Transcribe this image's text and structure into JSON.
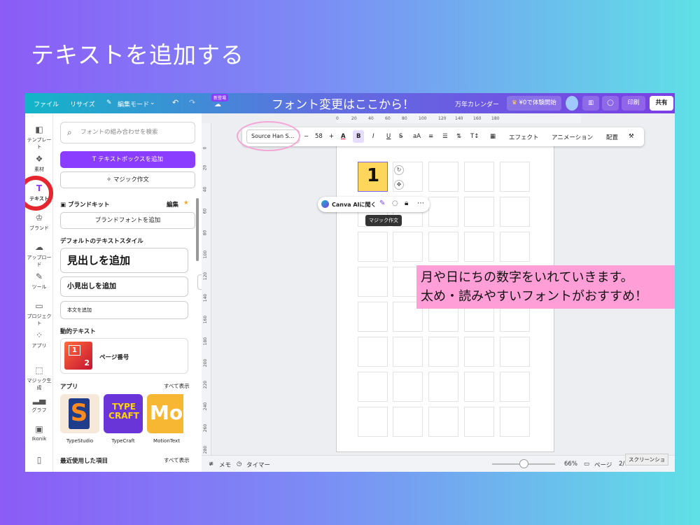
{
  "slide": {
    "title": "テキストを追加する"
  },
  "topbar": {
    "file": "ファイル",
    "resize": "リサイズ",
    "edit_mode": "編集モード",
    "new_badge": "新登場",
    "banner": "フォント変更はここから！",
    "doc_title": "万年カレンダー",
    "trial": "¥0で体験開始",
    "print": "印刷",
    "share": "共有"
  },
  "rail": {
    "items": [
      {
        "label": "テンプレート",
        "icon": "template-icon"
      },
      {
        "label": "素材",
        "icon": "elements-icon"
      },
      {
        "label": "テキスト",
        "icon": "text-icon"
      },
      {
        "label": "ブランド",
        "icon": "brand-icon"
      },
      {
        "label": "アップロード",
        "icon": "upload-icon"
      },
      {
        "label": "ツール",
        "icon": "tools-icon"
      },
      {
        "label": "プロジェクト",
        "icon": "folder-icon"
      },
      {
        "label": "アプリ",
        "icon": "apps-icon"
      },
      {
        "label": "マジック生成",
        "icon": "magic-icon"
      },
      {
        "label": "グラフ",
        "icon": "chart-icon"
      },
      {
        "label": "Ikonik",
        "icon": "ikonik-icon"
      }
    ]
  },
  "panel": {
    "search_placeholder": "フォントの組み合わせを検索",
    "add_textbox": "テキストボックスを追加",
    "magic_write": "マジック作文",
    "brand_kit": "ブランドキット",
    "edit": "編集",
    "add_brand_font": "ブランドフォントを追加",
    "default_styles": "デフォルトのテキストスタイル",
    "add_heading": "見出しを追加",
    "add_subheading": "小見出しを追加",
    "add_body": "本文を追加",
    "dynamic_text": "動的テキスト",
    "page_number": "ページ番号",
    "apps": "アプリ",
    "see_all": "すべて表示",
    "app_list": [
      "TypeStudio",
      "TypeCraft",
      "MotionText"
    ],
    "recent": "最近使用した項目",
    "see_all_2": "すべて表示"
  },
  "toolbar": {
    "font": "Source Han S...",
    "minus": "−",
    "size": "58",
    "plus": "+",
    "bold": "B",
    "italic": "I",
    "underline": "U",
    "case": "aA",
    "effects": "エフェクト",
    "animation": "アニメーション",
    "position": "配置"
  },
  "ruler": {
    "top": [
      "0",
      "20",
      "40",
      "60",
      "80",
      "100",
      "120",
      "140",
      "160",
      "180"
    ],
    "left": [
      "0",
      "20",
      "40",
      "60",
      "80",
      "100",
      "120",
      "140",
      "160",
      "180",
      "200",
      "220",
      "240",
      "260",
      "280"
    ]
  },
  "canvas": {
    "cell_number": "1",
    "ai_open": "Canva AIに聞く",
    "tooltip": "マジック作文",
    "note_line1": "月や日にちの数字をいれていきます。",
    "note_line2": "太め・読みやすいフォントがおすすめ！"
  },
  "bottombar": {
    "memo": "メモ",
    "timer": "タイマー",
    "zoom": "66%",
    "pages": "ページ",
    "page_count": "2/",
    "screenshot": "スクリーンショ"
  },
  "colors": {
    "accent": "#8b3dff",
    "highlight_ring": "#e6262e",
    "note_bg": "#ff9ed7"
  }
}
